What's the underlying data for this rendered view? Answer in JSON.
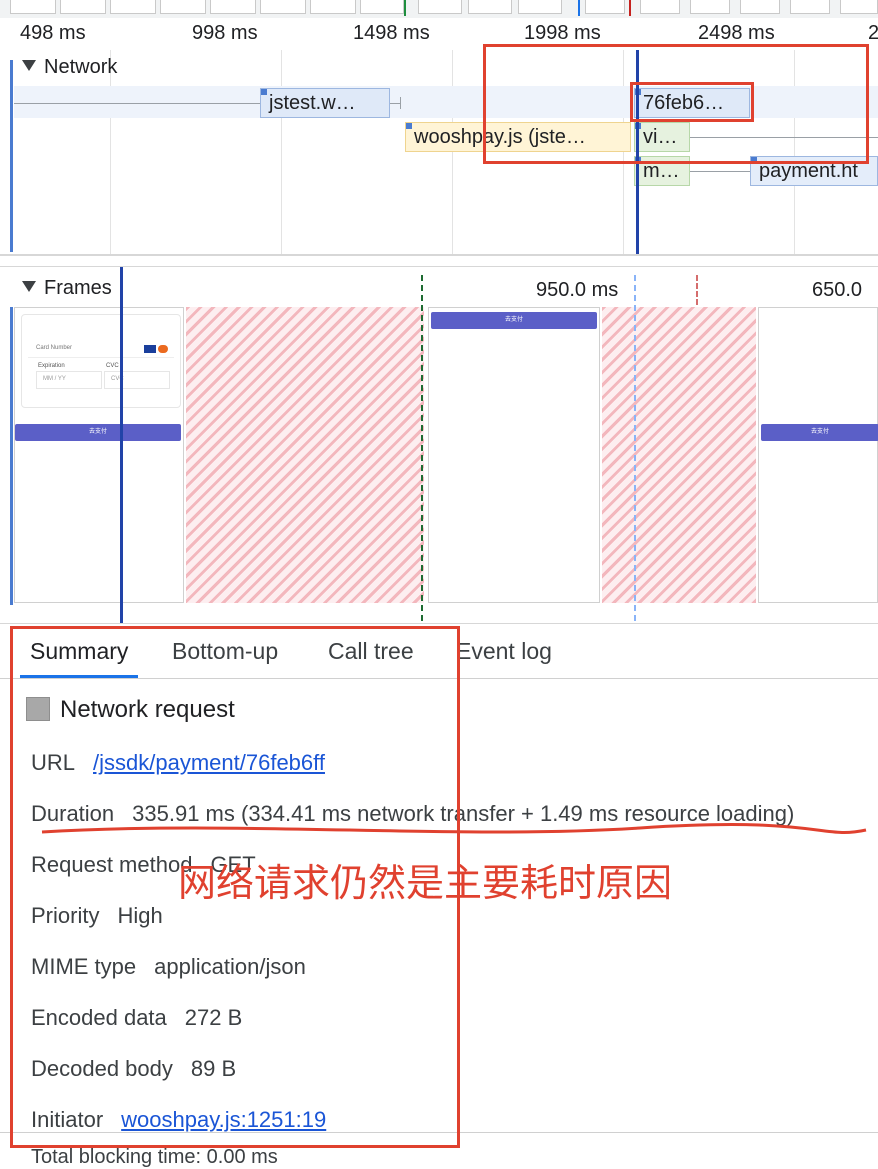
{
  "ruler": {
    "ticks": [
      "498 ms",
      "998 ms",
      "1498 ms",
      "1998 ms",
      "2498 ms",
      "2"
    ]
  },
  "network": {
    "title": "Network",
    "requests": {
      "jstest": "jstest.w…",
      "feb": "76feb6…",
      "wooshpay": "wooshpay.js (jste…",
      "vi": "vi…",
      "m": "m…",
      "payment": "payment.ht"
    }
  },
  "frames": {
    "title": "Frames",
    "durations": [
      "950.0 ms",
      "650.0"
    ],
    "thumb": {
      "card_number": "Card Number",
      "expiration": "Expiration",
      "cvc": "CVC",
      "mm_yy": "MM / YY",
      "cvc_placeholder": "CVC",
      "pay_button": "去支付"
    }
  },
  "tabs": [
    "Summary",
    "Bottom-up",
    "Call tree",
    "Event log"
  ],
  "summary": {
    "heading": "Network request",
    "url_label": "URL",
    "url_value": "/jssdk/payment/76feb6ff",
    "duration_label": "Duration",
    "duration_value": "335.91 ms (334.41 ms network transfer + 1.49 ms resource loading)",
    "method_label": "Request method",
    "method_value": "GET",
    "priority_label": "Priority",
    "priority_value": "High",
    "mime_label": "MIME type",
    "mime_value": "application/json",
    "encoded_label": "Encoded data",
    "encoded_value": "272 B",
    "decoded_label": "Decoded body",
    "decoded_value": "89 B",
    "initiator_label": "Initiator",
    "initiator_value": "wooshpay.js:1251:19",
    "footer_partial": "Total blocking time: 0.00 ms"
  },
  "annotation": {
    "text": "网络请求仍然是主要耗时原因"
  },
  "colors": {
    "annotation_red": "#e0412f",
    "link_blue": "#1a55d6",
    "selection_blue": "#1a73e8",
    "dropped_frame_pink": "#f3b7bd",
    "pay_button": "#5b5fc7"
  }
}
